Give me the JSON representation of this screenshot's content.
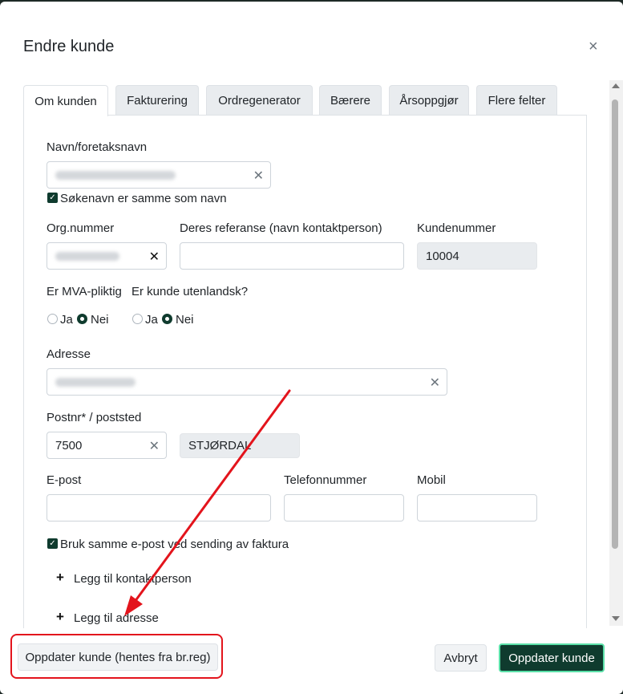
{
  "modal": {
    "title": "Endre kunde"
  },
  "tabs": [
    {
      "label": "Om kunden",
      "active": true
    },
    {
      "label": "Fakturering"
    },
    {
      "label": "Ordregenerator"
    },
    {
      "label": "Bærere"
    },
    {
      "label": "Årsoppgjør"
    },
    {
      "label": "Flere felter"
    }
  ],
  "form": {
    "name_label": "Navn/foretaksnavn",
    "search_same_label": "Søkenavn er samme som navn",
    "org_label": "Org.nummer",
    "ref_label": "Deres referanse (navn kontaktperson)",
    "customer_no_label": "Kundenummer",
    "customer_no_value": "10004",
    "vat_label": "Er MVA-pliktig",
    "foreign_label": "Er kunde utenlandsk?",
    "yes": "Ja",
    "no": "Nei",
    "address_label": "Adresse",
    "postcode_label": "Postnr* / poststed",
    "postcode_value": "7500",
    "city_value": "STJØRDAL",
    "email_label": "E-post",
    "phone_label": "Telefonnummer",
    "mobile_label": "Mobil",
    "same_email_label": "Bruk samme e-post ved sending av faktura",
    "add_contact": "Legg til kontaktperson",
    "add_address": "Legg til adresse"
  },
  "footer": {
    "update_brreg": "Oppdater kunde (hentes fra br.reg)",
    "cancel": "Avbryt",
    "update": "Oppdater kunde"
  },
  "colors": {
    "primary": "#0f3b2e",
    "annotation": "#e3141c"
  }
}
